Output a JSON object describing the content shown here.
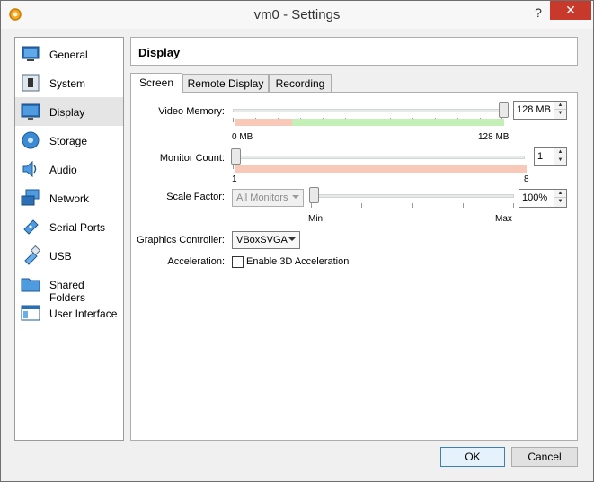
{
  "window": {
    "title": "vm0 - Settings",
    "help": "?",
    "close": "✕"
  },
  "sidebar": {
    "items": [
      {
        "label": "General",
        "icon": "general-icon"
      },
      {
        "label": "System",
        "icon": "system-icon"
      },
      {
        "label": "Display",
        "icon": "display-icon",
        "selected": true
      },
      {
        "label": "Storage",
        "icon": "storage-icon"
      },
      {
        "label": "Audio",
        "icon": "audio-icon"
      },
      {
        "label": "Network",
        "icon": "network-icon"
      },
      {
        "label": "Serial Ports",
        "icon": "serial-ports-icon"
      },
      {
        "label": "USB",
        "icon": "usb-icon"
      },
      {
        "label": "Shared Folders",
        "icon": "shared-folders-icon"
      },
      {
        "label": "User Interface",
        "icon": "user-interface-icon"
      }
    ]
  },
  "header": {
    "title": "Display"
  },
  "tabs": [
    {
      "label": "Screen",
      "active": true
    },
    {
      "label": "Remote Display",
      "active": false
    },
    {
      "label": "Recording",
      "active": false
    }
  ],
  "screen": {
    "video_memory": {
      "label": "Video Memory:",
      "value": "128 MB",
      "min_label": "0 MB",
      "max_label": "128 MB",
      "level": 1.0
    },
    "monitor_count": {
      "label": "Monitor Count:",
      "value": "1",
      "min_label": "1",
      "max_label": "8",
      "level": 0.0
    },
    "scale_factor": {
      "label": "Scale Factor:",
      "combo_value": "All Monitors",
      "value": "100%",
      "min_label": "Min",
      "max_label": "Max",
      "level": 0.0
    },
    "graphics_controller": {
      "label": "Graphics Controller:",
      "value": "VBoxSVGA"
    },
    "acceleration": {
      "label": "Acceleration:",
      "checkbox_label": "Enable 3D Acceleration",
      "checked": false
    }
  },
  "buttons": {
    "ok": "OK",
    "cancel": "Cancel"
  },
  "colors": {
    "zone_bad": "#f8c8b8",
    "zone_good": "#c4f0b8",
    "accent": "#3c7fb1",
    "close": "#c7392b"
  }
}
